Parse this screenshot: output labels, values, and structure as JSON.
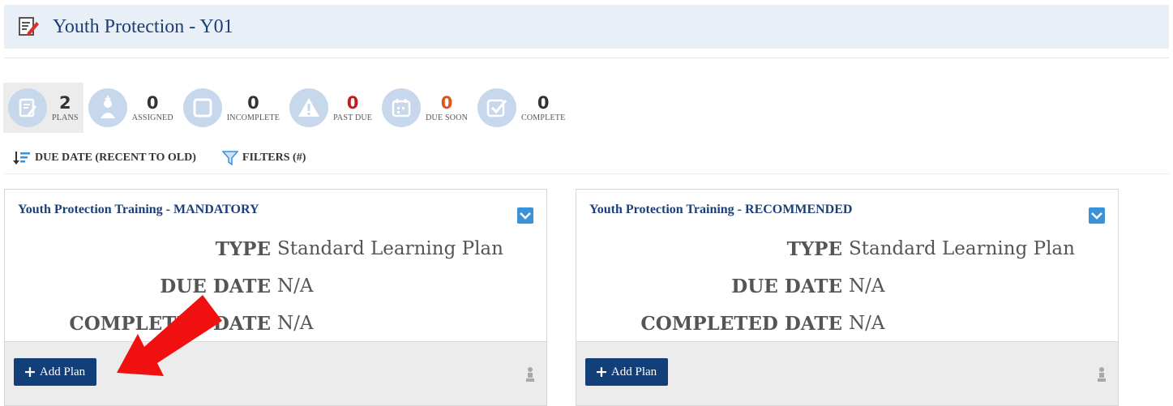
{
  "header": {
    "title": "Youth Protection - Y01",
    "icon": "edit-document-icon"
  },
  "stats": [
    {
      "num": "2",
      "label": "PLANS",
      "icon": "edit-document-icon",
      "color": "#333333",
      "active": true
    },
    {
      "num": "0",
      "label": "ASSIGNED",
      "icon": "person-download-icon",
      "color": "#333333"
    },
    {
      "num": "0",
      "label": "INCOMPLETE",
      "icon": "square-icon",
      "color": "#333333"
    },
    {
      "num": "0",
      "label": "PAST DUE",
      "icon": "warning-icon",
      "color": "#c21d1d"
    },
    {
      "num": "0",
      "label": "DUE SOON",
      "icon": "calendar-icon",
      "color": "#e0531a"
    },
    {
      "num": "0",
      "label": "COMPLETE",
      "icon": "checkbox-icon",
      "color": "#333333"
    }
  ],
  "toolbar": {
    "sort_label": "DUE DATE (RECENT TO OLD)",
    "filters_label": "FILTERS (#)"
  },
  "cards": [
    {
      "title": "Youth Protection Training - MANDATORY",
      "type_key": "TYPE",
      "type_val": "Standard Learning Plan",
      "due_key": "DUE DATE",
      "due_val": "N/A",
      "completed_key": "COMPLETED DATE",
      "completed_val": "N/A",
      "button": "Add Plan"
    },
    {
      "title": "Youth Protection Training - RECOMMENDED",
      "type_key": "TYPE",
      "type_val": "Standard Learning Plan",
      "due_key": "DUE DATE",
      "due_val": "N/A",
      "completed_key": "COMPLETED DATE",
      "completed_val": "N/A",
      "button": "Add Plan"
    }
  ],
  "colors": {
    "brand": "#1d3f78",
    "button": "#123f7a",
    "accent": "#3a92d9",
    "arrow": "#f01010"
  }
}
